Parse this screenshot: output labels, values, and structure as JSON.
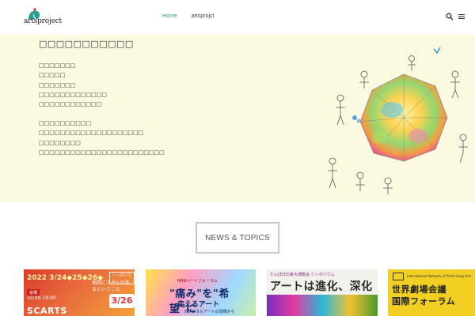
{
  "header": {
    "logo_text": "artsproject",
    "nav": [
      {
        "label": "Home",
        "active": true
      },
      {
        "label": "artsprojct",
        "active": false
      }
    ],
    "icons": [
      "search-icon",
      "hamburger-menu-icon"
    ]
  },
  "hero": {
    "title": "□□□□□□□□□□□",
    "list1": [
      "□□□□□□□",
      "□□□□□",
      "□□□□□□□",
      "□□□□□□□□□□□□□",
      "□□□□□□□□□□□□"
    ],
    "list2": [
      "□□□□□□□□□□",
      "□□□□□□□□□□□□□□□□□□□□",
      "□□□□□□□□",
      "□□□□□□□□□□□□□□□□□□□□□□□□"
    ]
  },
  "news": {
    "button_label": "NEWS & TOPICS"
  },
  "cards": {
    "card1": {
      "date": "2022 3/24◆25◆26◆",
      "badge": "会場",
      "time": "10:00-19:00",
      "main": "SCARTS",
      "right": "病院にアートがあるということ",
      "big": "3/26",
      "tag": "シンポジウム"
    },
    "card2": {
      "head": "NHKハートフォーラム",
      "main": "\"痛み\"を\"希望\"に",
      "sub": "変えるアート",
      "foot": "ホスピタルアートの現場から"
    },
    "card3": {
      "top": "たんぽぽの家大博覧会 シンポジウム",
      "main": "アートは進化、深化す"
    },
    "card4": {
      "top": "International Network of Performing Arts",
      "main1": "世界劇場会議",
      "main2": "国際フォーラム"
    }
  },
  "colors": {
    "accent": "#2aa090",
    "hero_bg": "#fcf9e1"
  }
}
